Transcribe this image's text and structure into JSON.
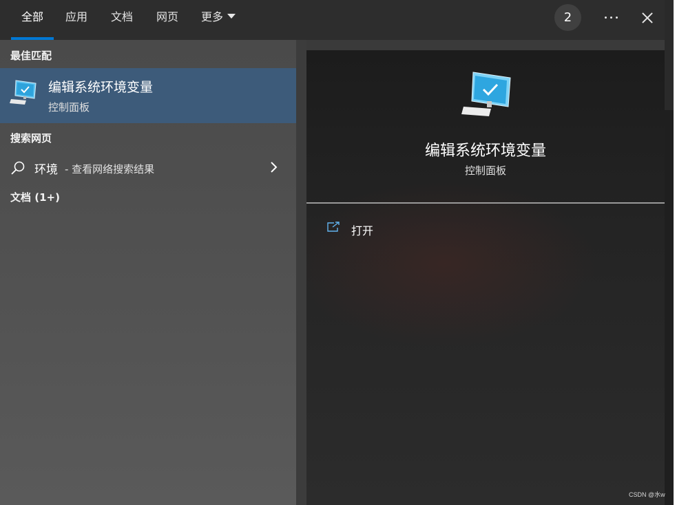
{
  "tabs": [
    {
      "label": "全部",
      "active": true
    },
    {
      "label": "应用"
    },
    {
      "label": "文档"
    },
    {
      "label": "网页"
    },
    {
      "label": "更多"
    }
  ],
  "badge_count": "2",
  "left_pane": {
    "best_match_header": "最佳匹配",
    "best_match": {
      "name": "编辑系统环境变量",
      "category": "控制面板",
      "icon": "computer-settings-icon"
    },
    "web_header": "搜索网页",
    "web_result": {
      "term": "环境",
      "description": "- 查看网络搜索结果"
    },
    "docs_header": "文档 (1+)"
  },
  "right_pane": {
    "title": "编辑系统环境变量",
    "subtitle": "控制面板",
    "action_open": "打开"
  },
  "watermark": "CSDN @水w",
  "colors": {
    "accent": "#0078d4",
    "selection": "#3d5b7a",
    "pane_dark": "#242424"
  }
}
